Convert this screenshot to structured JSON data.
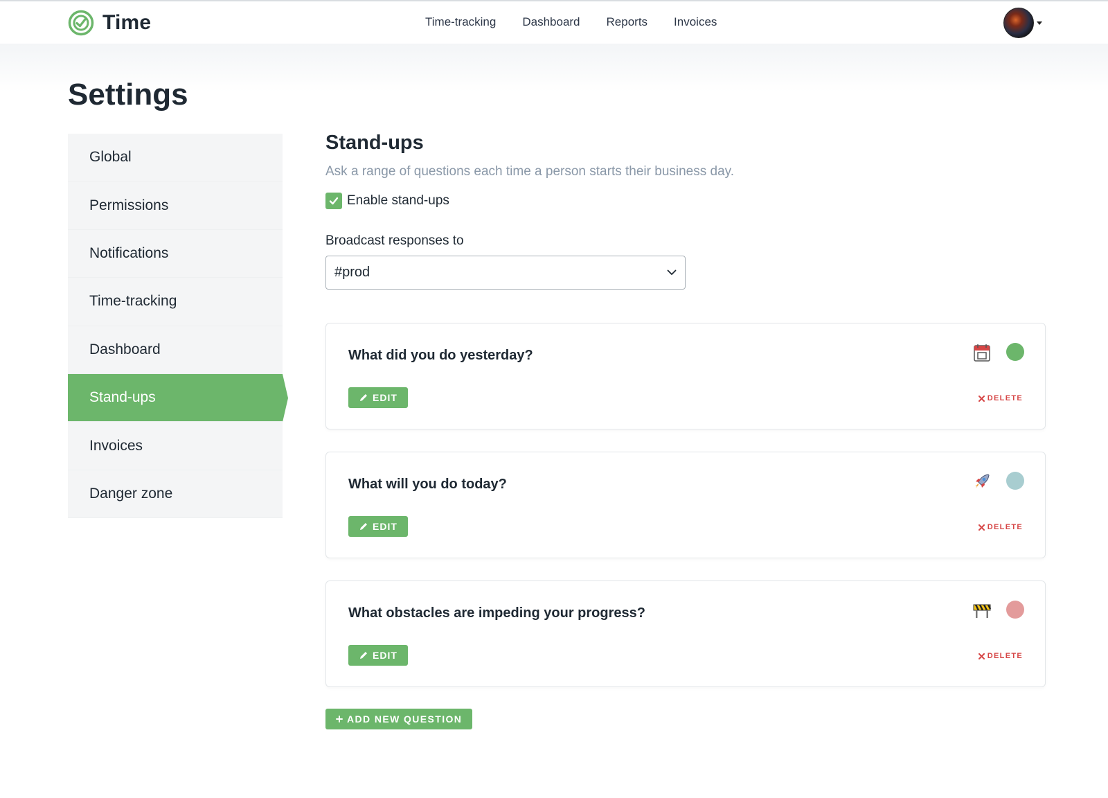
{
  "app": {
    "name": "Time",
    "logo_icon": "time-logo-icon",
    "accent": "#6cb66b"
  },
  "nav": {
    "links": [
      {
        "label": "Time-tracking"
      },
      {
        "label": "Dashboard"
      },
      {
        "label": "Reports"
      },
      {
        "label": "Invoices"
      }
    ],
    "user_menu_icon": "chevron-down-icon"
  },
  "page": {
    "title": "Settings"
  },
  "sidebar": {
    "items": [
      {
        "label": "Global",
        "active": false
      },
      {
        "label": "Permissions",
        "active": false
      },
      {
        "label": "Notifications",
        "active": false
      },
      {
        "label": "Time-tracking",
        "active": false
      },
      {
        "label": "Dashboard",
        "active": false
      },
      {
        "label": "Stand-ups",
        "active": true
      },
      {
        "label": "Invoices",
        "active": false
      },
      {
        "label": "Danger zone",
        "active": false
      }
    ]
  },
  "standups": {
    "title": "Stand-ups",
    "subtitle": "Ask a range of questions each time a person starts their business day.",
    "enable": {
      "label": "Enable stand-ups",
      "checked": true
    },
    "broadcast": {
      "label": "Broadcast responses to",
      "value": "#prod"
    },
    "questions": [
      {
        "text": "What did you do yesterday?",
        "emoji": "calendar-icon",
        "color": "#6cb66b"
      },
      {
        "text": "What will you do today?",
        "emoji": "rocket-icon",
        "color": "#a8cdd0"
      },
      {
        "text": "What obstacles are impeding your progress?",
        "emoji": "construction-icon",
        "color": "#e39b9b"
      }
    ],
    "edit_label": "EDIT",
    "delete_label": "DELETE",
    "add_label": "ADD NEW QUESTION"
  }
}
